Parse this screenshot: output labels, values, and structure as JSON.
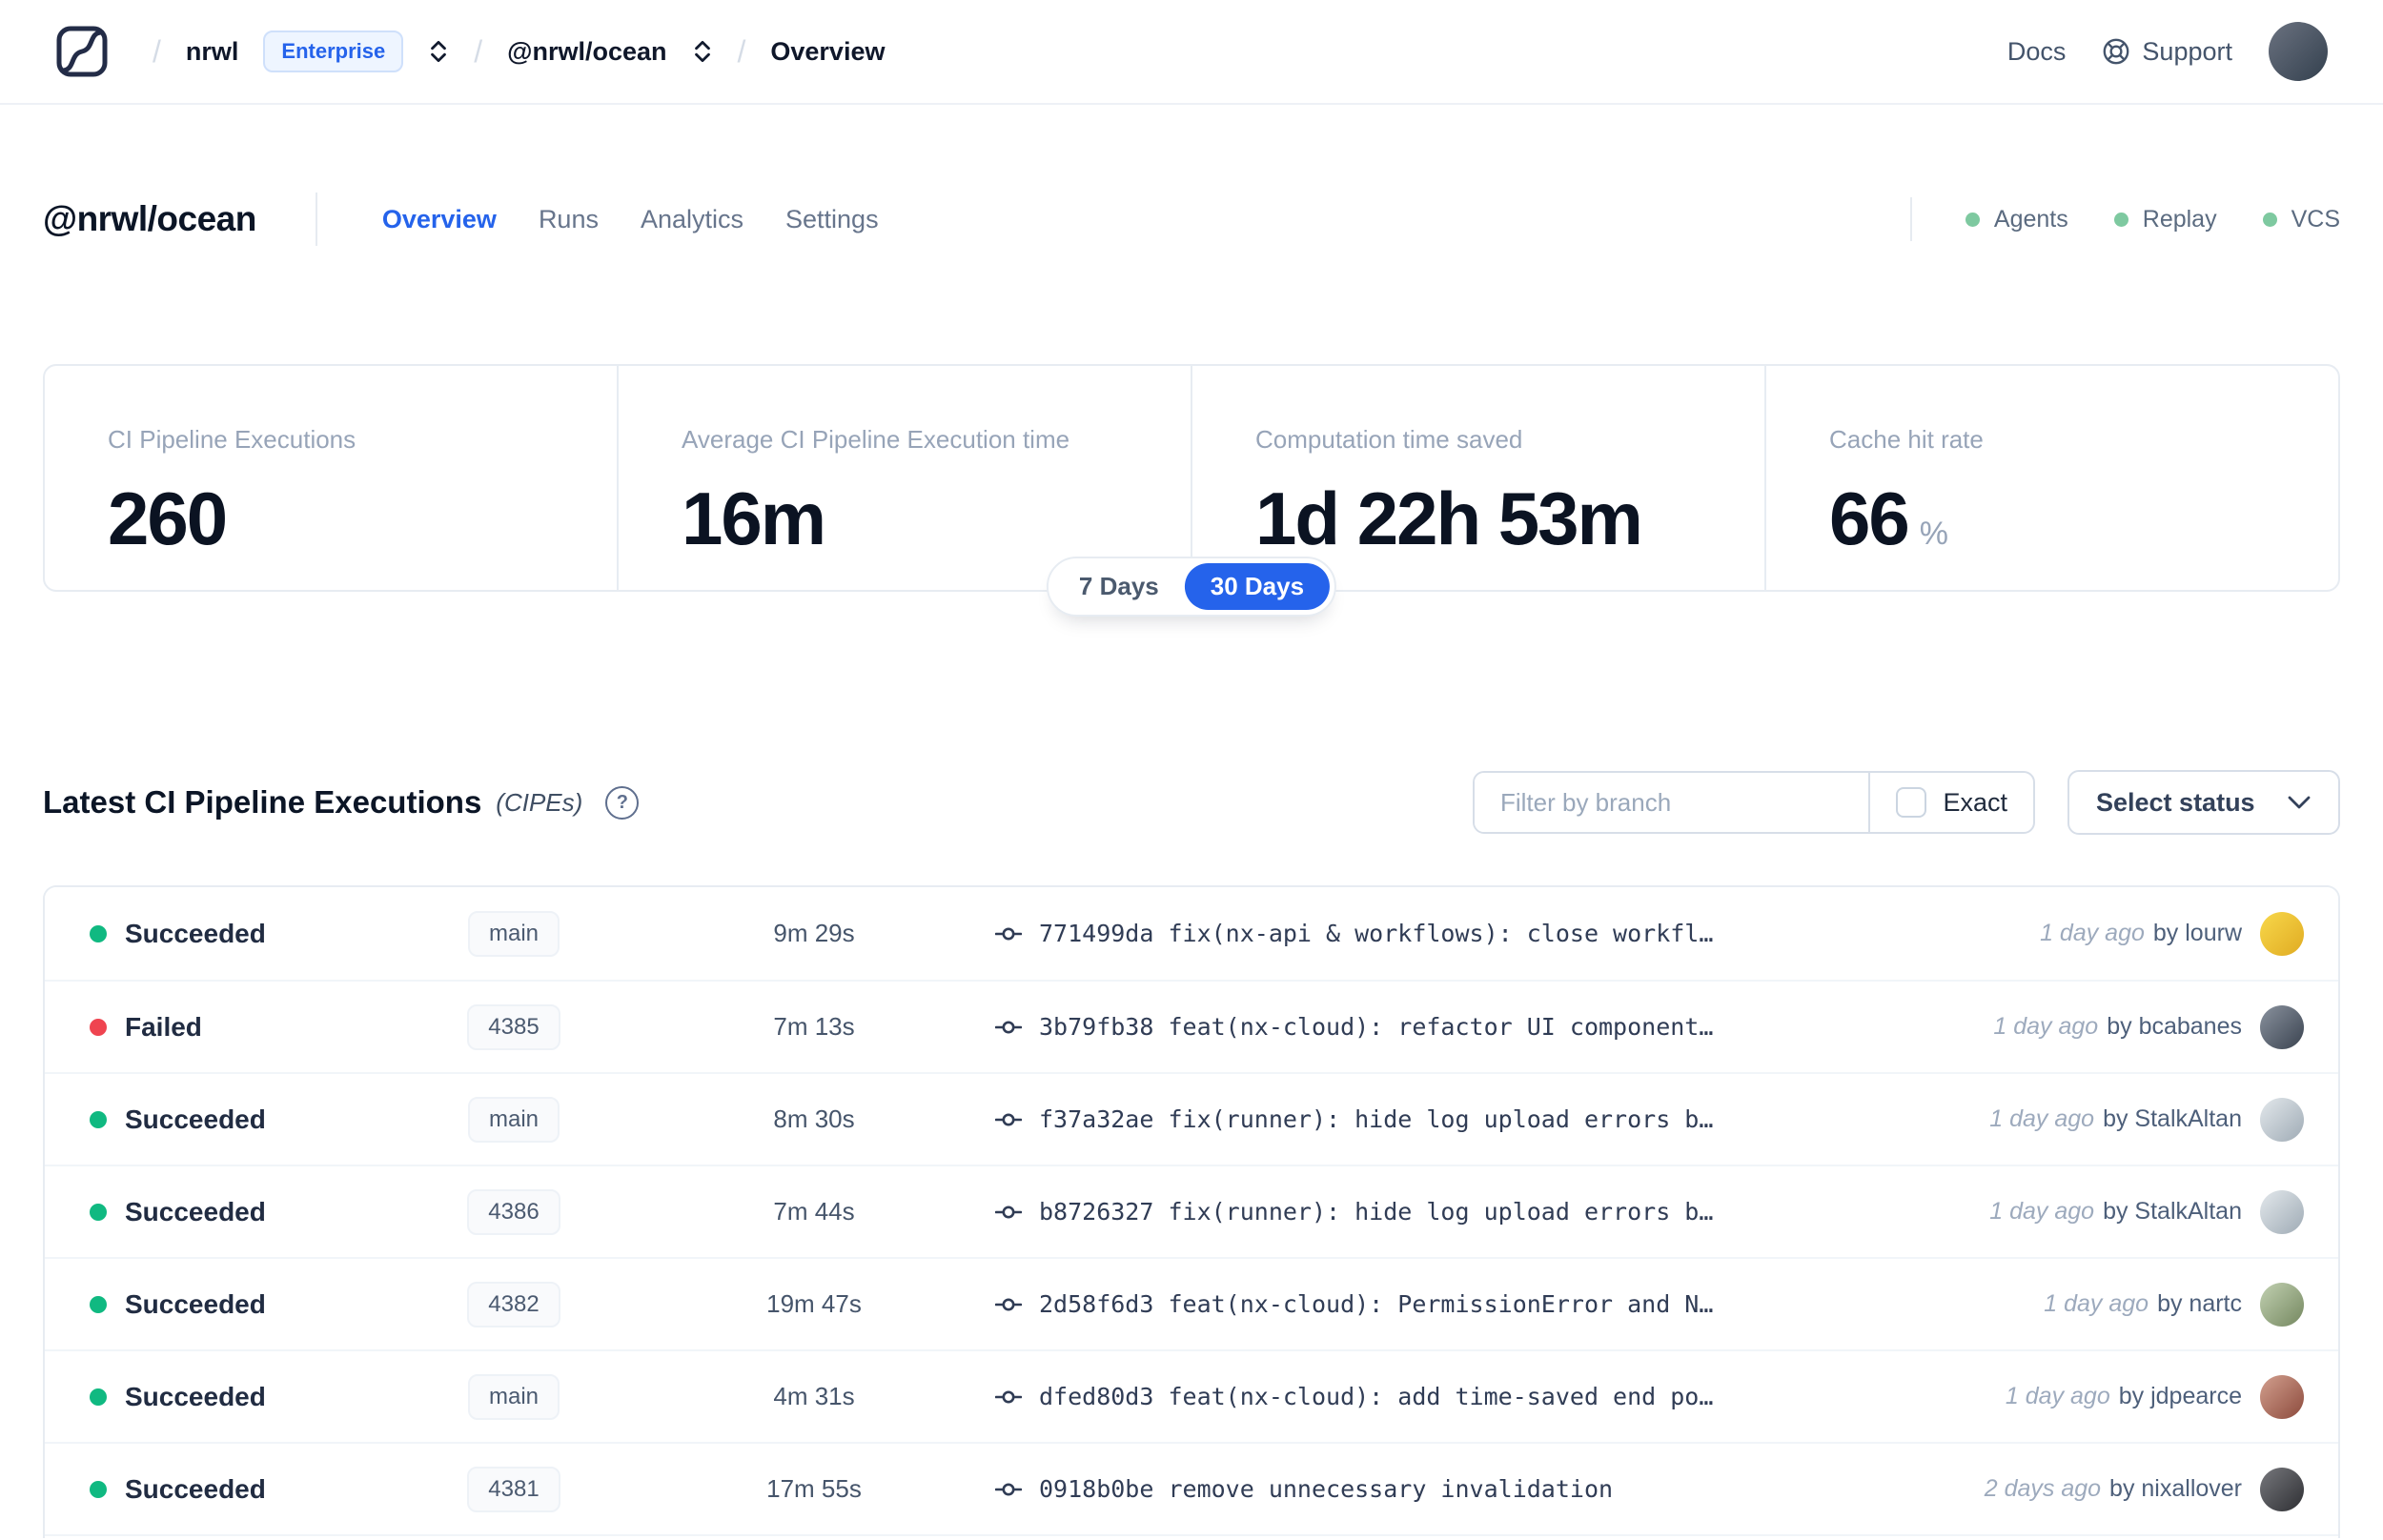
{
  "colors": {
    "accent_blue": "#2563eb",
    "success_green": "#10b981",
    "failed_red": "#ef4450",
    "indicator_green": "#7ec9a0"
  },
  "navbar": {
    "separator": "/",
    "org": "nrwl",
    "org_badge": "Enterprise",
    "workspace": "@nrwl/ocean",
    "page": "Overview",
    "docs_label": "Docs",
    "support_label": "Support",
    "avatar_colors": [
      "#6b7280",
      "#33404e"
    ],
    "icons": {
      "logo": "nx-cloud-logo",
      "expand": "chevron-up-down-icon",
      "support": "lifebuoy-icon"
    }
  },
  "header": {
    "title": "@nrwl/ocean",
    "tabs": [
      {
        "label": "Overview",
        "active": true
      },
      {
        "label": "Runs",
        "active": false
      },
      {
        "label": "Analytics",
        "active": false
      },
      {
        "label": "Settings",
        "active": false
      }
    ],
    "indicators": [
      "Agents",
      "Replay",
      "VCS"
    ]
  },
  "stats": {
    "cards": [
      {
        "label": "CI Pipeline Executions",
        "value": "260",
        "unit": ""
      },
      {
        "label": "Average CI Pipeline Execution time",
        "value": "16m",
        "unit": ""
      },
      {
        "label": "Computation time saved",
        "value": "1d 22h 53m",
        "unit": ""
      },
      {
        "label": "Cache hit rate",
        "value": "66",
        "unit": "%"
      }
    ],
    "range_toggle": {
      "options": [
        {
          "label": "7 Days",
          "selected": false
        },
        {
          "label": "30 Days",
          "selected": true
        }
      ]
    }
  },
  "executions": {
    "title": "Latest CI Pipeline Executions",
    "subtitle": "(CIPEs)",
    "help_glyph": "?",
    "filter_placeholder": "Filter by branch",
    "filter_value": "",
    "exact_label": "Exact",
    "exact_checked": false,
    "status_select_label": "Select status",
    "rows": [
      {
        "status": "Succeeded",
        "status_color": "#10b981",
        "branch": "main",
        "duration": "9m 29s",
        "commit": "771499da",
        "message": "fix(nx-api & workflows): close workfl…",
        "time_ago": "1 day ago",
        "author": "by lourw",
        "avatar_colors": [
          "#f8d84b",
          "#e0ab22"
        ]
      },
      {
        "status": "Failed",
        "status_color": "#ef4450",
        "branch": "4385",
        "duration": "7m 13s",
        "commit": "3b79fb38",
        "message": "feat(nx-cloud): refactor UI component…",
        "time_ago": "1 day ago",
        "author": "by bcabanes",
        "avatar_colors": [
          "#8a929e",
          "#3a4350"
        ]
      },
      {
        "status": "Succeeded",
        "status_color": "#10b981",
        "branch": "main",
        "duration": "8m 30s",
        "commit": "f37a32ae",
        "message": "fix(runner): hide log upload errors b…",
        "time_ago": "1 day ago",
        "author": "by StalkAltan",
        "avatar_colors": [
          "#e3e8ec",
          "#9fabb5"
        ]
      },
      {
        "status": "Succeeded",
        "status_color": "#10b981",
        "branch": "4386",
        "duration": "7m 44s",
        "commit": "b8726327",
        "message": "fix(runner): hide log upload errors b…",
        "time_ago": "1 day ago",
        "author": "by StalkAltan",
        "avatar_colors": [
          "#e3e8ec",
          "#9fabb5"
        ]
      },
      {
        "status": "Succeeded",
        "status_color": "#10b981",
        "branch": "4382",
        "duration": "19m 47s",
        "commit": "2d58f6d3",
        "message": "feat(nx-cloud): PermissionError and N…",
        "time_ago": "1 day ago",
        "author": "by nartc",
        "avatar_colors": [
          "#c2d1b2",
          "#74875f"
        ]
      },
      {
        "status": "Succeeded",
        "status_color": "#10b981",
        "branch": "main",
        "duration": "4m 31s",
        "commit": "dfed80d3",
        "message": "feat(nx-cloud): add time-saved end po…",
        "time_ago": "1 day ago",
        "author": "by jdpearce",
        "avatar_colors": [
          "#d3a08f",
          "#8c4a3c"
        ]
      },
      {
        "status": "Succeeded",
        "status_color": "#10b981",
        "branch": "4381",
        "duration": "17m 55s",
        "commit": "0918b0be",
        "message": "remove unnecessary invalidation",
        "time_ago": "2 days ago",
        "author": "by nixallover",
        "avatar_colors": [
          "#77787d",
          "#2e2f33"
        ]
      }
    ]
  }
}
